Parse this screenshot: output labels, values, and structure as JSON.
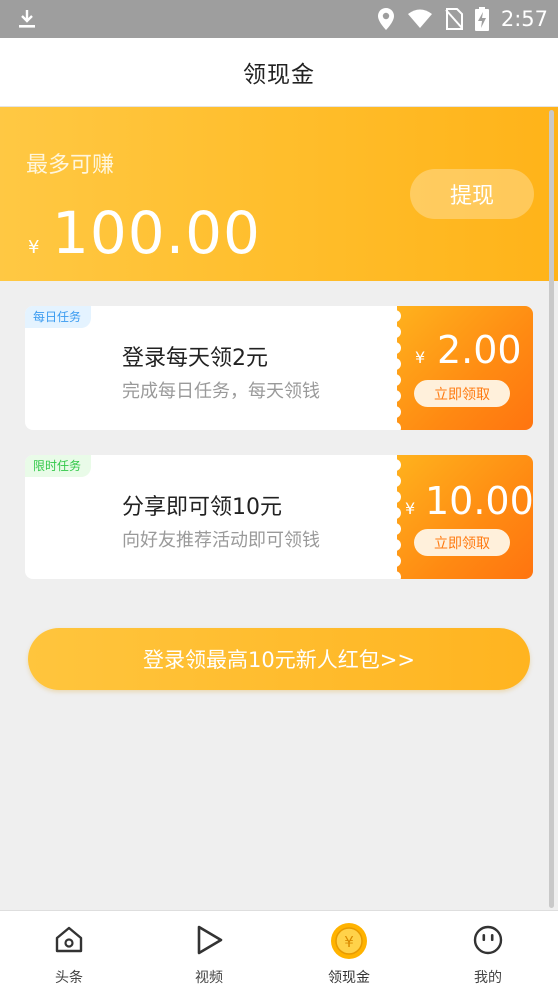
{
  "status_bar": {
    "time": "2:57",
    "icons": [
      "download-icon",
      "location-icon",
      "wifi-icon",
      "no-sim-icon",
      "battery-charging-icon"
    ]
  },
  "header": {
    "title": "领现金"
  },
  "banner": {
    "label": "最多可赚",
    "currency": "¥",
    "amount": "100.00",
    "withdraw_label": "提现"
  },
  "tasks": [
    {
      "tag": "每日任务",
      "title": "登录每天领2元",
      "description": "完成每日任务，每天领钱",
      "currency": "¥",
      "value": "2.00",
      "claim_label": "立即领取"
    },
    {
      "tag": "限时任务",
      "title": "分享即可领10元",
      "description": "向好友推荐活动即可领钱",
      "currency": "¥",
      "value": "10.00",
      "claim_label": "立即领取"
    }
  ],
  "promo_button": {
    "label": "登录领最高10元新人红包>>"
  },
  "bottom_nav": {
    "items": [
      {
        "label": "头条",
        "icon": "home-icon"
      },
      {
        "label": "视频",
        "icon": "play-icon"
      },
      {
        "label": "领现金",
        "icon": "coin-icon",
        "active": true
      },
      {
        "label": "我的",
        "icon": "face-icon"
      }
    ]
  },
  "colors": {
    "accent": "#ffb319",
    "ticket": "#ff8a12",
    "tag_blue": "#3a9bf0",
    "tag_green": "#33c94a"
  }
}
